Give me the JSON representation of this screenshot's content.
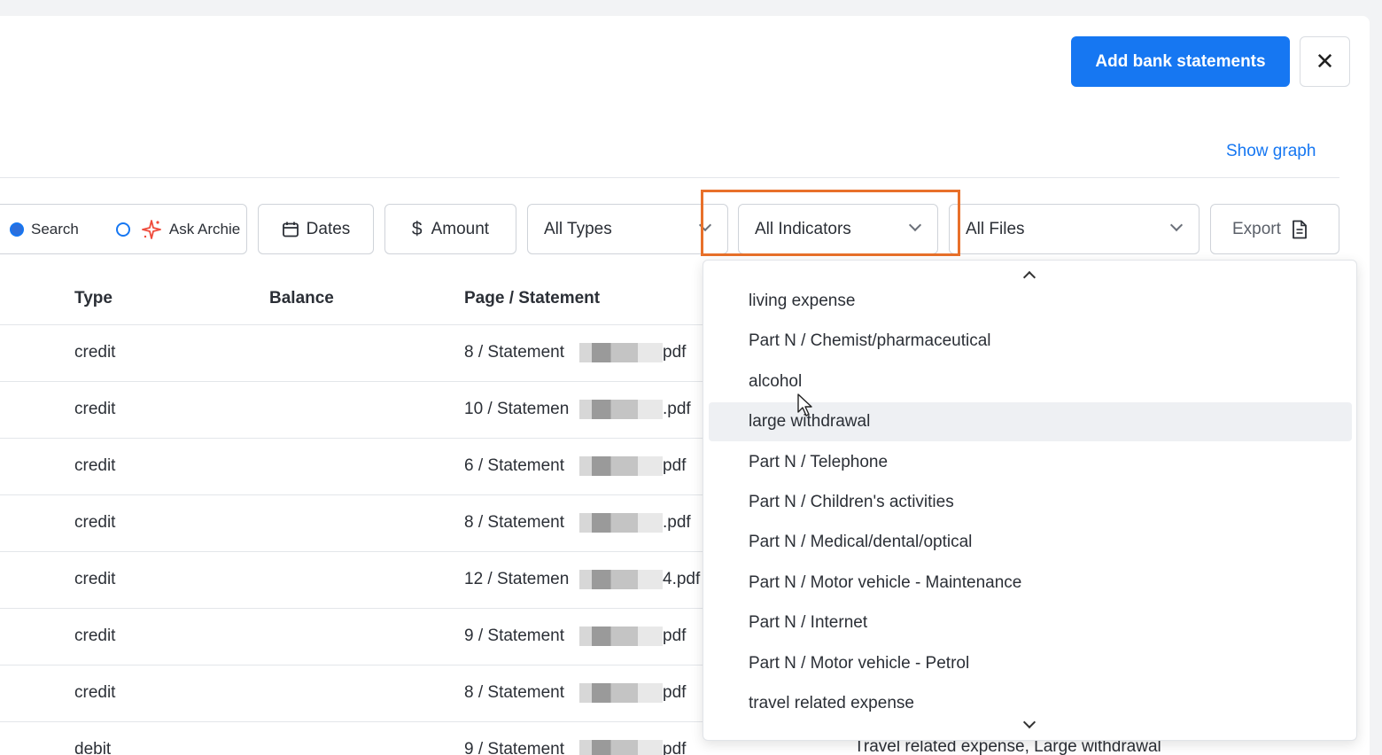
{
  "header": {
    "add_button": "Add bank statements",
    "close_glyph": "✕",
    "show_graph": "Show graph"
  },
  "filters": {
    "search_label": "Search",
    "ask_label": "Ask Archie",
    "dates_label": "Dates",
    "amount_label": "Amount",
    "amount_symbol": "$",
    "types_label": "All Types",
    "indicators_label": "All Indicators",
    "files_label": "All Files",
    "export_label": "Export"
  },
  "table": {
    "columns": [
      "Type",
      "Balance",
      "Page / Statement"
    ],
    "rows": [
      {
        "type": "credit",
        "page_prefix": "8 / Statement",
        "page_suffix": "pdf"
      },
      {
        "type": "credit",
        "page_prefix": "10 / Statemen",
        "page_suffix": ".pdf"
      },
      {
        "type": "credit",
        "page_prefix": "6 / Statement",
        "page_suffix": "pdf"
      },
      {
        "type": "credit",
        "page_prefix": "8 / Statement",
        "page_suffix": ".pdf"
      },
      {
        "type": "credit",
        "page_prefix": "12 / Statemen",
        "page_suffix": "4.pdf"
      },
      {
        "type": "credit",
        "page_prefix": "9 / Statement",
        "page_suffix": "pdf"
      },
      {
        "type": "credit",
        "page_prefix": "8 / Statement",
        "page_suffix": "pdf"
      },
      {
        "type": "debit",
        "page_prefix": "9 / Statement",
        "page_suffix": "pdf"
      }
    ],
    "peek_indicators": "Travel related expense, Large withdrawal"
  },
  "indicator_dropdown": {
    "items": [
      "living expense",
      "Part N / Chemist/pharmaceutical",
      "alcohol",
      "large withdrawal",
      "Part N / Telephone",
      "Part N / Children's activities",
      "Part N / Medical/dental/optical",
      "Part N / Motor vehicle - Maintenance",
      "Part N / Internet",
      "Part N / Motor vehicle - Petrol",
      "travel related expense"
    ],
    "hovered_index": 3
  },
  "colors": {
    "primary": "#1677f2",
    "highlight": "#e8702a",
    "sparkle": "#ef4b3b"
  },
  "icons": {
    "calendar": "calendar-icon",
    "dollar": "dollar-icon",
    "export": "file-export-icon",
    "sparkle": "sparkle-icon"
  }
}
